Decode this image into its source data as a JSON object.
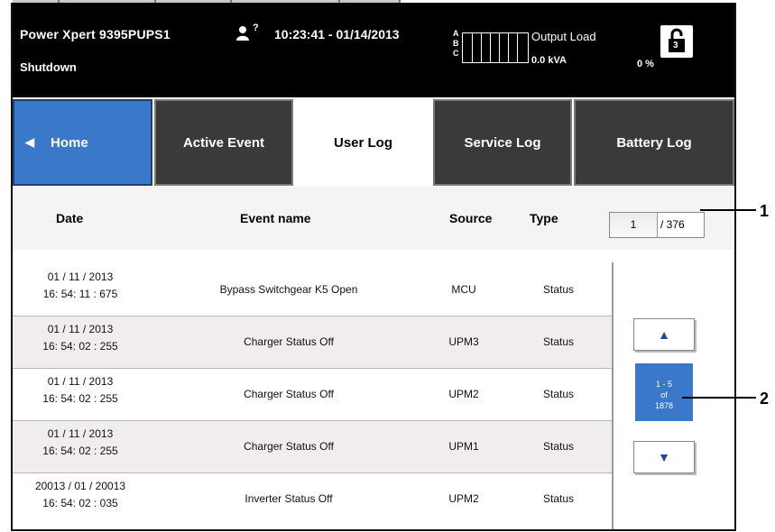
{
  "header": {
    "title": "Power Xpert 9395PUPS1",
    "status": "Shutdown",
    "help_mark": "?",
    "time_date": "10:23:41 - 01/14/2013",
    "phases": [
      "A",
      "B",
      "C"
    ],
    "output_load_label": "Output Load",
    "output_kva": "0.0 kVA",
    "output_pct": "0 %",
    "lock_level": "3"
  },
  "tabs": [
    {
      "label": "Home"
    },
    {
      "label": "Active Event"
    },
    {
      "label": "User Log"
    },
    {
      "label": "Service Log"
    },
    {
      "label": "Battery Log"
    }
  ],
  "columns": {
    "date": "Date",
    "event": "Event name",
    "source": "Source",
    "type": "Type"
  },
  "page": {
    "current": "1",
    "total": "/ 376"
  },
  "rows": [
    {
      "date": "01 / 11 / 2013",
      "time": "16: 54: 11 : 675",
      "event": "Bypass Switchgear K5 Open",
      "source": "MCU",
      "type": "Status"
    },
    {
      "date": "01 / 11 / 2013",
      "time": "16: 54: 02 : 255",
      "event": "Charger Status Off",
      "source": "UPM3",
      "type": "Status"
    },
    {
      "date": "01 / 11 / 2013",
      "time": "16: 54: 02 : 255",
      "event": "Charger Status Off",
      "source": "UPM2",
      "type": "Status"
    },
    {
      "date": "01 / 11 / 2013",
      "time": "16: 54: 02 : 255",
      "event": "Charger Status Off",
      "source": "UPM1",
      "type": "Status"
    },
    {
      "date": "20013 / 01 / 20013",
      "time": "16: 54: 02 : 035",
      "event": "Inverter Status Off",
      "source": "UPM2",
      "type": "Status"
    }
  ],
  "pager": {
    "range": "1  -  5",
    "of": "of",
    "count": "1878"
  },
  "callouts": [
    "1",
    "2"
  ],
  "colors": {
    "accent_blue": "#3a78c9",
    "header_bg": "#000000",
    "tab_dark": "#3a3a3a"
  }
}
